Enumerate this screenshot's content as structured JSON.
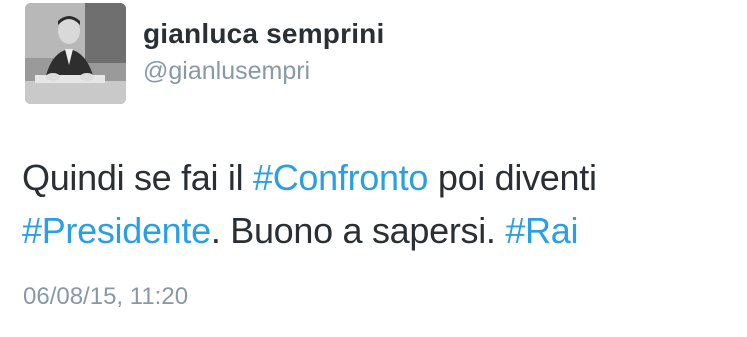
{
  "author": {
    "display_name": "gianluca semprini",
    "handle": "@gianlusempri"
  },
  "tweet": {
    "line1_before": "Quindi se fai il ",
    "hashtag_confronto": "#Confronto",
    "line1_after": " poi diventi",
    "hashtag_presidente": "#Presidente",
    "line2_middle": ". Buono a sapersi. ",
    "hashtag_rai": "#Rai"
  },
  "timestamp": "06/08/15, 11:20",
  "colors": {
    "text": "#292f33",
    "hashtag": "#2b9fe5",
    "muted": "#8899a6"
  },
  "icons": {
    "avatar": "profile-photo-man-at-desk"
  }
}
